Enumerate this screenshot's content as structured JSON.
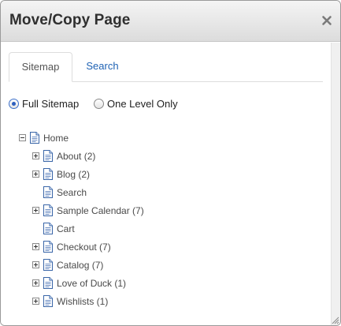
{
  "dialog": {
    "title": "Move/Copy Page",
    "close_symbol": "×"
  },
  "tabs": [
    {
      "label": "Sitemap",
      "active": true
    },
    {
      "label": "Search",
      "active": false
    }
  ],
  "radios": [
    {
      "label": "Full Sitemap",
      "checked": true
    },
    {
      "label": "One Level Only",
      "checked": false
    }
  ],
  "tree": {
    "root": {
      "label": "Home",
      "expander": "minus",
      "icon": "page-icon"
    },
    "children": [
      {
        "label": "About (2)",
        "expander": "plus",
        "icon": "page-icon"
      },
      {
        "label": "Blog (2)",
        "expander": "plus",
        "icon": "page-icon"
      },
      {
        "label": "Search",
        "expander": "none",
        "icon": "page-icon"
      },
      {
        "label": "Sample Calendar (7)",
        "expander": "plus",
        "icon": "page-icon"
      },
      {
        "label": "Cart",
        "expander": "none",
        "icon": "page-icon"
      },
      {
        "label": "Checkout (7)",
        "expander": "plus",
        "icon": "page-icon"
      },
      {
        "label": "Catalog (7)",
        "expander": "plus",
        "icon": "page-icon"
      },
      {
        "label": "Love of Duck (1)",
        "expander": "plus",
        "icon": "page-icon"
      },
      {
        "label": "Wishlists (1)",
        "expander": "plus",
        "icon": "page-icon"
      }
    ]
  },
  "colors": {
    "link_blue": "#1e62b4",
    "icon_blue": "#3a66a8",
    "text": "#4a4a4a"
  }
}
